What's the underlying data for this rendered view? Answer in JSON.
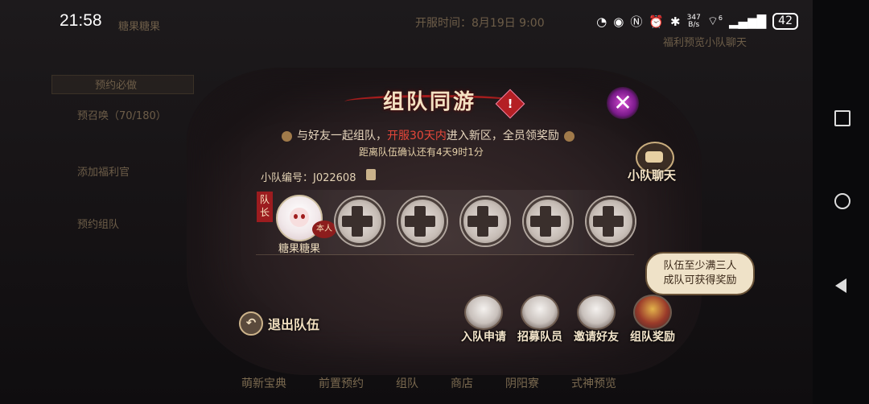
{
  "status_bar": {
    "time": "21:58",
    "net_speed_value": "347",
    "net_speed_unit": "B/s",
    "wifi_label": "6",
    "battery": "42"
  },
  "background": {
    "player_name": "糖果糖果",
    "server_time": "开服时间：8月19日 9:00",
    "reserve_title": "预约必做",
    "welfare_preview": "福利预览",
    "team_chat": "小队聊天",
    "tasks": [
      "预召唤（70/180）",
      "添加福利官",
      "预约组队"
    ],
    "bottom_tabs": [
      "萌新宝典",
      "前置预约",
      "组队",
      "商店",
      "阴阳寮",
      "式神预览"
    ]
  },
  "modal": {
    "title": "组队同游",
    "info_icon": "!",
    "description_prefix": "与好友一起组队，",
    "description_highlight": "开服30天内",
    "description_suffix": "进入新区，全员领奖励",
    "countdown": "距离队伍确认还有4天9时1分",
    "team_id_label": "小队编号：J022608",
    "chat_label": "小队聊天",
    "leader_tag": "队长",
    "leader": {
      "name": "糖果糖果",
      "badge": "本人"
    },
    "empty_slots": 5,
    "leave_label": "退出队伍",
    "tip": "队伍至少满三人成队可获得奖励",
    "actions": [
      {
        "label": "入队申请",
        "icon": "join-request-icon"
      },
      {
        "label": "招募队员",
        "icon": "recruit-icon"
      },
      {
        "label": "邀请好友",
        "icon": "invite-friends-icon"
      },
      {
        "label": "组队奖励",
        "icon": "team-reward-icon"
      }
    ]
  },
  "colors": {
    "accent_red": "#e8473a",
    "title_ribbon": "#a41d1d",
    "text_cream": "#f1dfbf"
  }
}
